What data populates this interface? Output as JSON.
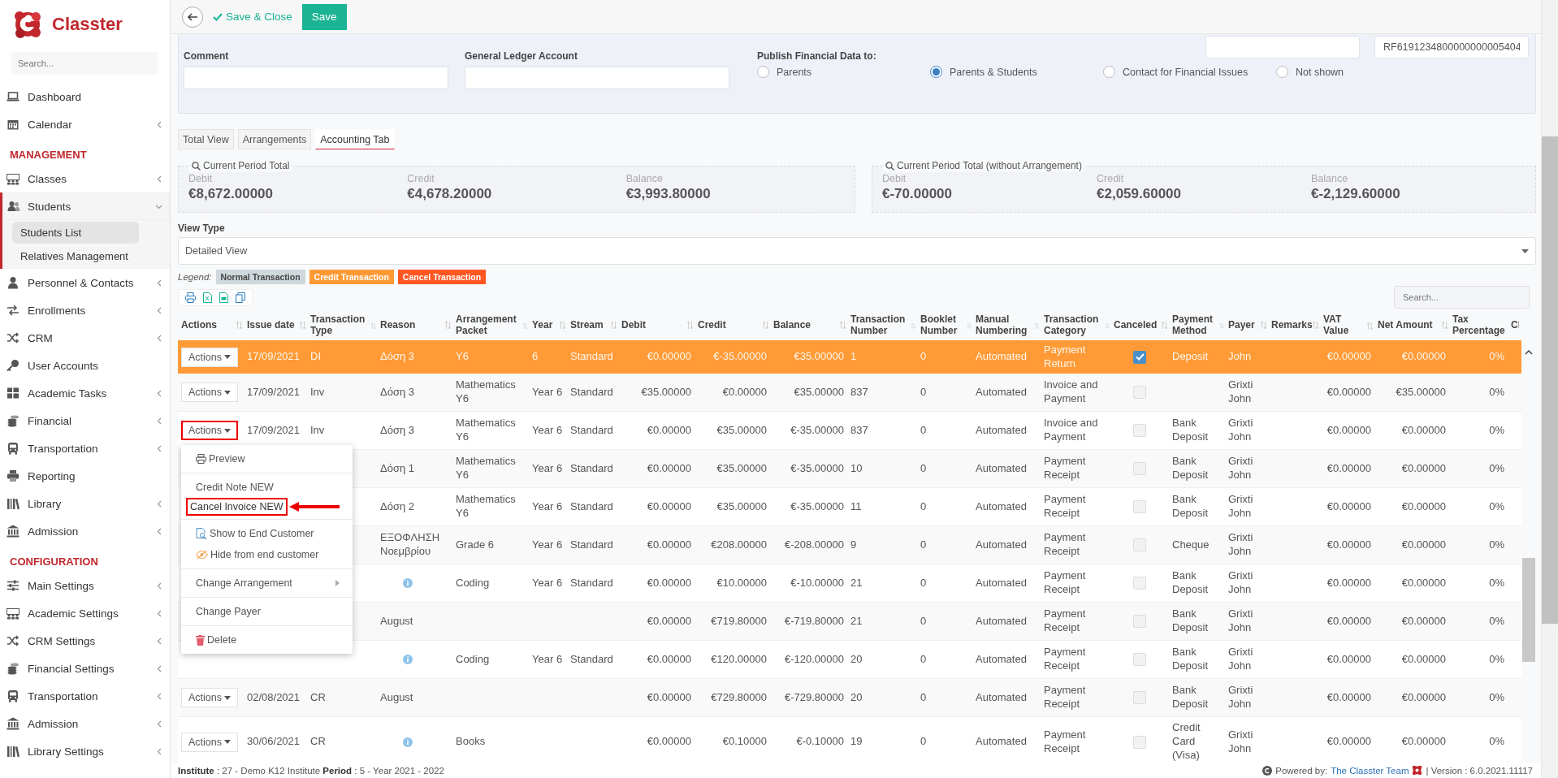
{
  "sidebar": {
    "brand": "Classter",
    "search": {
      "placeholder": "Search..."
    },
    "sections": [
      {
        "items": [
          {
            "label": "Dashboard",
            "submenu": false,
            "expanded": false
          },
          {
            "label": "Calendar",
            "submenu": true,
            "expanded": false
          }
        ]
      },
      {
        "title": "MANAGEMENT",
        "items": [
          {
            "label": "Classes",
            "submenu": true,
            "expanded": false
          },
          {
            "label": "Students",
            "submenu": true,
            "expanded": true,
            "children": [
              {
                "label": "Students List",
                "selected": true
              },
              {
                "label": "Relatives Management",
                "selected": false
              }
            ]
          },
          {
            "label": "Personnel & Contacts",
            "submenu": true,
            "expanded": false
          },
          {
            "label": "Enrollments",
            "submenu": true,
            "expanded": false
          },
          {
            "label": "CRM",
            "submenu": true,
            "expanded": false
          },
          {
            "label": "User Accounts",
            "submenu": false,
            "expanded": false
          },
          {
            "label": "Academic Tasks",
            "submenu": true,
            "expanded": false
          },
          {
            "label": "Financial",
            "submenu": true,
            "expanded": false
          },
          {
            "label": "Transportation",
            "submenu": true,
            "expanded": false
          },
          {
            "label": "Reporting",
            "submenu": false,
            "expanded": false
          },
          {
            "label": "Library",
            "submenu": true,
            "expanded": false
          },
          {
            "label": "Admission",
            "submenu": true,
            "expanded": false
          }
        ]
      },
      {
        "title": "CONFIGURATION",
        "items": [
          {
            "label": "Main Settings",
            "submenu": true,
            "expanded": false
          },
          {
            "label": "Academic Settings",
            "submenu": true,
            "expanded": false
          },
          {
            "label": "CRM Settings",
            "submenu": true,
            "expanded": false
          },
          {
            "label": "Financial Settings",
            "submenu": true,
            "expanded": false
          },
          {
            "label": "Transportation",
            "submenu": true,
            "expanded": false
          },
          {
            "label": "Admission",
            "submenu": true,
            "expanded": false
          },
          {
            "label": "Library Settings",
            "submenu": true,
            "expanded": false
          }
        ]
      }
    ]
  },
  "toolbar": {
    "save_close": "Save & Close",
    "save": "Save"
  },
  "form": {
    "reference": {
      "value": "RF6191234800000000005404"
    },
    "fields": [
      {
        "label": "Comment"
      },
      {
        "label": "General Ledger Account"
      }
    ],
    "publish": {
      "label": "Publish Financial Data to:",
      "options": [
        {
          "label": "Parents",
          "selected": false
        },
        {
          "label": "Parents & Students",
          "selected": true
        },
        {
          "label": "Contact for Financial Issues",
          "selected": false
        },
        {
          "label": "Not shown",
          "selected": false
        }
      ]
    }
  },
  "tabs": [
    {
      "label": "Total View",
      "selected": false
    },
    {
      "label": "Arrangements",
      "selected": false
    },
    {
      "label": "Accounting Tab",
      "selected": true
    }
  ],
  "totals": [
    {
      "title": "Current Period Total",
      "items": [
        {
          "label": "Debit",
          "value": "€8,672.00000"
        },
        {
          "label": "Credit",
          "value": "€4,678.20000"
        },
        {
          "label": "Balance",
          "value": "€3,993.80000"
        }
      ]
    },
    {
      "title": "Current Period Total (without Arrangement)",
      "items": [
        {
          "label": "Debit",
          "value": "€-70.00000"
        },
        {
          "label": "Credit",
          "value": "€2,059.60000"
        },
        {
          "label": "Balance",
          "value": "€-2,129.60000"
        }
      ]
    }
  ],
  "view_type": {
    "label": "View Type",
    "value": "Detailed View"
  },
  "legend": {
    "label": "Legend:",
    "items": [
      {
        "label": "Normal Transaction",
        "color": "#cfd8dc"
      },
      {
        "label": "Credit Transaction",
        "color": "#ff9933"
      },
      {
        "label": "Cancel Transaction",
        "color": "#ff5722"
      }
    ]
  },
  "table": {
    "search": {
      "placeholder": "Search..."
    },
    "columns": [
      "Actions",
      "Issue date",
      "Transaction Type",
      "Reason",
      "Arrangement Packet",
      "Year",
      "Stream",
      "Debit",
      "Credit",
      "Balance",
      "Transaction Number",
      "Booklet Number",
      "Manual Numbering",
      "Transaction Category",
      "Canceled",
      "Payment Method",
      "Payer",
      "Remarks",
      "VAT Value",
      "Net Amount",
      "Tax Percentage",
      "Cl"
    ],
    "rows": [
      {
        "kind": "credit",
        "actions": "Actions",
        "actions_highlighted": false,
        "menu_open": false,
        "issue_date": "17/09/2021",
        "type": "DI",
        "reason": "Δόση 3",
        "info": false,
        "packet": "Y6",
        "year": "6",
        "stream": "Standard",
        "debit": "€0.00000",
        "credit": "€-35.00000",
        "balance": "€35.00000",
        "number": "1",
        "booklet": "0",
        "numbering": "Automated",
        "category": "Payment Return",
        "canceled": true,
        "method": "Deposit",
        "payer": "John",
        "vat": "€0.00000",
        "net": "€0.00000",
        "tax": "0%"
      },
      {
        "kind": "normal",
        "actions": "Actions",
        "actions_highlighted": false,
        "menu_open": false,
        "issue_date": "17/09/2021",
        "type": "Inv",
        "reason": "Δόση 3",
        "info": false,
        "packet": "Mathematics Y6",
        "year": "Year 6",
        "stream": "Standard",
        "debit": "€35.00000",
        "credit": "€0.00000",
        "balance": "€35.00000",
        "number": "837",
        "booklet": "0",
        "numbering": "Automated",
        "category": "Invoice and Payment",
        "canceled": false,
        "payer": "Grixti John",
        "vat": "€0.00000",
        "net": "€35.00000",
        "tax": "0%"
      },
      {
        "kind": "normal",
        "actions": "Actions",
        "actions_highlighted": true,
        "menu_open": true,
        "issue_date": "17/09/2021",
        "type": "Inv",
        "reason": "Δόση 3",
        "info": false,
        "packet": "Mathematics Y6",
        "year": "Year 6",
        "stream": "Standard",
        "debit": "€0.00000",
        "credit": "€35.00000",
        "balance": "€-35.00000",
        "number": "837",
        "booklet": "0",
        "numbering": "Automated",
        "category": "Invoice and Payment",
        "canceled": false,
        "method": "Bank Deposit",
        "payer": "Grixti John",
        "vat": "€0.00000",
        "net": "€0.00000",
        "tax": "0%"
      },
      {
        "kind": "normal",
        "reason": "Δόση 1",
        "info": false,
        "packet": "Mathematics Y6",
        "year": "Year 6",
        "stream": "Standard",
        "debit": "€0.00000",
        "credit": "€35.00000",
        "balance": "€-35.00000",
        "number": "10",
        "booklet": "0",
        "numbering": "Automated",
        "category": "Payment Receipt",
        "canceled": false,
        "method": "Bank Deposit",
        "payer": "Grixti John",
        "vat": "€0.00000",
        "net": "€0.00000",
        "tax": "0%"
      },
      {
        "kind": "normal",
        "reason": "Δόση 2",
        "info": false,
        "packet": "Mathematics Y6",
        "year": "Year 6",
        "stream": "Standard",
        "debit": "€0.00000",
        "credit": "€35.00000",
        "balance": "€-35.00000",
        "number": "11",
        "booklet": "0",
        "numbering": "Automated",
        "category": "Payment Receipt",
        "canceled": false,
        "method": "Bank Deposit",
        "payer": "Grixti John",
        "vat": "€0.00000",
        "net": "€0.00000",
        "tax": "0%"
      },
      {
        "kind": "normal",
        "reason": "ΕΞΟΦΛΗΣΗ Νοεμβρίου",
        "info": false,
        "packet": "Grade 6",
        "year": "Year 6",
        "stream": "Standard",
        "debit": "€0.00000",
        "credit": "€208.00000",
        "balance": "€-208.00000",
        "number": "9",
        "booklet": "0",
        "numbering": "Automated",
        "category": "Payment Receipt",
        "canceled": false,
        "method": "Cheque",
        "payer": "Grixti John",
        "vat": "€0.00000",
        "net": "€0.00000",
        "tax": "0%"
      },
      {
        "kind": "normal",
        "info": true,
        "packet": "Coding",
        "year": "Year 6",
        "stream": "Standard",
        "debit": "€0.00000",
        "credit": "€10.00000",
        "balance": "€-10.00000",
        "number": "21",
        "booklet": "0",
        "numbering": "Automated",
        "category": "Payment Receipt",
        "canceled": false,
        "method": "Bank Deposit",
        "payer": "Grixti John",
        "vat": "€0.00000",
        "net": "€0.00000",
        "tax": "0%"
      },
      {
        "kind": "normal",
        "reason": "August",
        "info": false,
        "debit": "€0.00000",
        "credit": "€719.80000",
        "balance": "€-719.80000",
        "number": "21",
        "booklet": "0",
        "numbering": "Automated",
        "category": "Payment Receipt",
        "canceled": false,
        "method": "Bank Deposit",
        "payer": "Grixti John",
        "vat": "€0.00000",
        "net": "€0.00000",
        "tax": "0%"
      },
      {
        "kind": "normal",
        "info": true,
        "packet": "Coding",
        "year": "Year 6",
        "stream": "Standard",
        "debit": "€0.00000",
        "credit": "€120.00000",
        "balance": "€-120.00000",
        "number": "20",
        "booklet": "0",
        "numbering": "Automated",
        "category": "Payment Receipt",
        "canceled": false,
        "method": "Bank Deposit",
        "payer": "Grixti John",
        "vat": "€0.00000",
        "net": "€0.00000",
        "tax": "0%"
      },
      {
        "kind": "normal",
        "actions": "Actions",
        "actions_highlighted": false,
        "menu_open": false,
        "issue_date": "02/08/2021",
        "type": "CR",
        "reason": "August",
        "info": false,
        "debit": "€0.00000",
        "credit": "€729.80000",
        "balance": "€-729.80000",
        "number": "20",
        "booklet": "0",
        "numbering": "Automated",
        "category": "Payment Receipt",
        "canceled": false,
        "method": "Bank Deposit",
        "payer": "Grixti John",
        "vat": "€0.00000",
        "net": "€0.00000",
        "tax": "0%"
      },
      {
        "kind": "normal",
        "actions": "Actions",
        "actions_highlighted": false,
        "menu_open": false,
        "issue_date": "30/06/2021",
        "type": "CR",
        "info": true,
        "packet": "Books",
        "debit": "€0.00000",
        "credit": "€0.10000",
        "balance": "€-0.10000",
        "number": "19",
        "booklet": "0",
        "numbering": "Automated",
        "category": "Payment Receipt",
        "canceled": false,
        "method": "Credit Card (Visa)",
        "payer": "Grixti John",
        "vat": "€0.00000",
        "net": "€0.00000",
        "tax": "0%"
      }
    ]
  },
  "actions_menu": {
    "groups": [
      [
        {
          "label": "Preview",
          "kind": "print",
          "highlighted": false
        }
      ],
      [
        {
          "label": "Credit Note NEW",
          "kind": "plain",
          "highlighted": false
        },
        {
          "label": "Cancel Invoice NEW",
          "kind": "plain",
          "highlighted": true
        }
      ],
      [
        {
          "label": "Show to End Customer",
          "kind": "show",
          "highlighted": false
        },
        {
          "label": "Hide from end customer",
          "kind": "hide",
          "highlighted": false
        }
      ],
      [
        {
          "label": "Change Arrangement",
          "kind": "submenu",
          "highlighted": false
        }
      ],
      [
        {
          "label": "Change Payer",
          "kind": "plain",
          "highlighted": false
        }
      ],
      [
        {
          "label": "Delete",
          "kind": "delete",
          "highlighted": false
        }
      ]
    ]
  },
  "footer": {
    "info": "**Institute** : 27 - Demo K12 Institute **Period** : 5 - Year 2021 - 2022",
    "powered_by": "Powered by:",
    "team_link": "The Classter Team",
    "version": "| Version : 6.0.2021.11117"
  }
}
